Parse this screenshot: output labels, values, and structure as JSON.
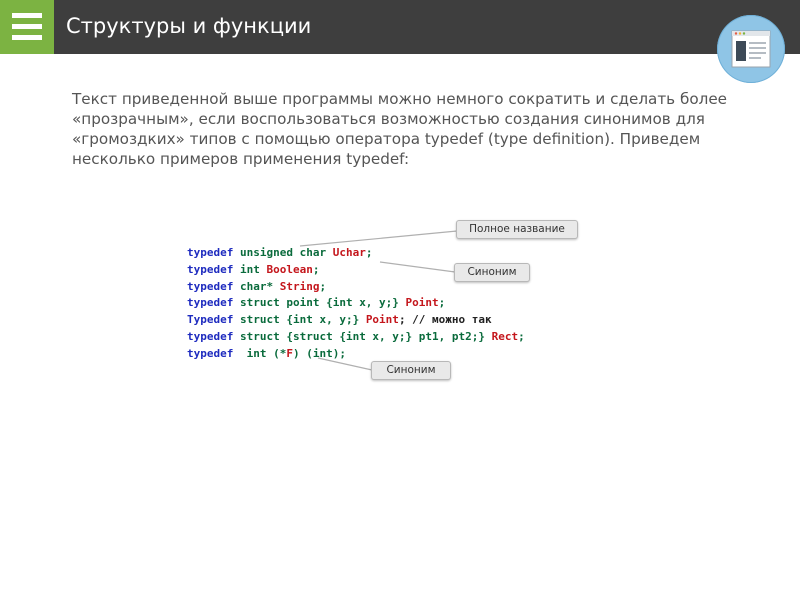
{
  "header": {
    "title": "Структуры и функции",
    "menu_icon": "hamburger-menu-icon",
    "badge_icon": "document-icon"
  },
  "colors": {
    "header_bg": "#3e3e3e",
    "menu_bg": "#7cb342",
    "badge_bg": "#8fc5e6",
    "keyword": "#1e2bbf",
    "type": "#0a6b3c",
    "name": "#c4161c"
  },
  "intro": "Текст приведенной выше программы можно немного сократить и сделать более «прозрачным», если воспользоваться возможностью создания синонимов для «громоздких» типов с помощью оператора typedef (type definition). Приведем несколько примеров применения typedef:",
  "code": {
    "lines": [
      [
        {
          "t": "typedef",
          "c": "kw"
        },
        {
          "t": " unsigned char ",
          "c": "ty"
        },
        {
          "t": "Uchar",
          "c": "nm"
        },
        {
          "t": ";",
          "c": "ty"
        }
      ],
      [
        {
          "t": "typedef",
          "c": "kw"
        },
        {
          "t": " int ",
          "c": "ty"
        },
        {
          "t": "Boolean",
          "c": "nm"
        },
        {
          "t": ";",
          "c": "ty"
        }
      ],
      [
        {
          "t": "typedef",
          "c": "kw"
        },
        {
          "t": " char* ",
          "c": "ty"
        },
        {
          "t": "String",
          "c": "nm"
        },
        {
          "t": ";",
          "c": "ty"
        }
      ],
      [
        {
          "t": "typedef",
          "c": "kw"
        },
        {
          "t": " struct point {int x, y;} ",
          "c": "ty"
        },
        {
          "t": "Point",
          "c": "nm"
        },
        {
          "t": ";",
          "c": "ty"
        }
      ],
      [
        {
          "t": "Typedef",
          "c": "kw"
        },
        {
          "t": " struct {int x, y;} ",
          "c": "ty"
        },
        {
          "t": "Point",
          "c": "nm"
        },
        {
          "t": "; // можно так",
          "c": "cm"
        }
      ],
      [
        {
          "t": "typedef",
          "c": "kw"
        },
        {
          "t": " struct {struct {int x, y;} pt1, pt2;} ",
          "c": "ty"
        },
        {
          "t": "Rect",
          "c": "nm"
        },
        {
          "t": ";",
          "c": "ty"
        }
      ],
      [
        {
          "t": "typedef",
          "c": "kw"
        },
        {
          "t": "  int (*",
          "c": "ty"
        },
        {
          "t": "F",
          "c": "nm"
        },
        {
          "t": ") (int);",
          "c": "ty"
        }
      ]
    ]
  },
  "callouts": {
    "full_name": "Полное название",
    "synonym_1": "Синоним",
    "synonym_2": "Синоним"
  }
}
